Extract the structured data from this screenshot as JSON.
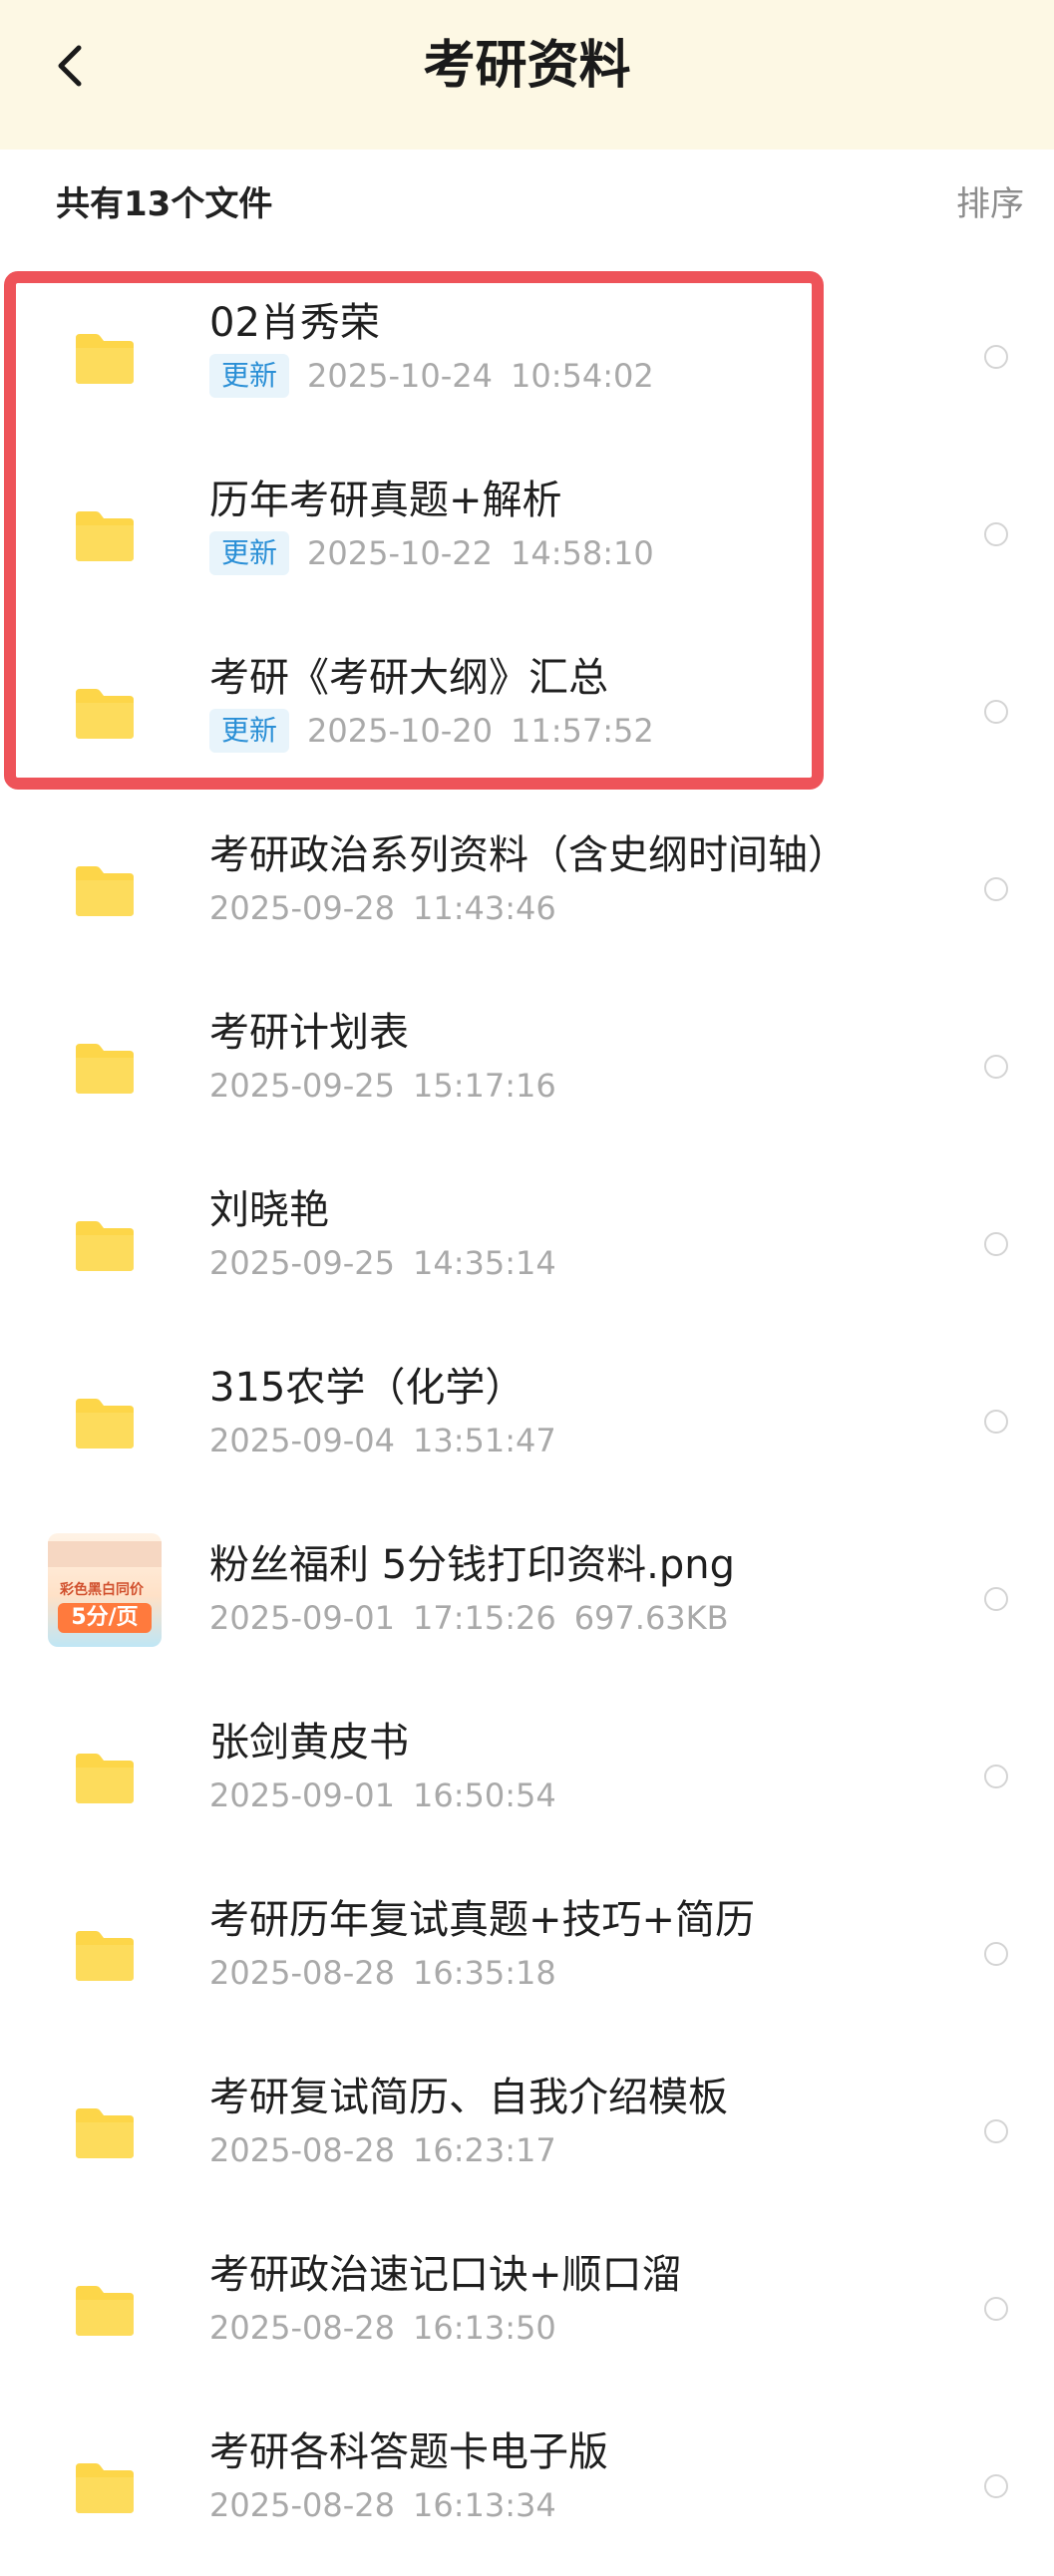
{
  "header": {
    "title": "考研资料",
    "back_icon": "back-arrow-icon"
  },
  "subheader": {
    "count_label": "共有13个文件",
    "sort_label": "排序"
  },
  "colors": {
    "header_bg": "#fdf8e4",
    "folder": "#fdd649",
    "update_badge_text": "#2a8fd6",
    "highlight": "#ee5359"
  },
  "files": [
    {
      "name": "02肖秀荣",
      "badge": "更新",
      "date": "2025-10-24",
      "time": "10:54:02",
      "size": "",
      "type": "folder",
      "icon": "folder-icon"
    },
    {
      "name": "历年考研真题+解析",
      "badge": "更新",
      "date": "2025-10-22",
      "time": "14:58:10",
      "size": "",
      "type": "folder",
      "icon": "folder-icon"
    },
    {
      "name": "考研《考研大纲》汇总",
      "badge": "更新",
      "date": "2025-10-20",
      "time": "11:57:52",
      "size": "",
      "type": "folder",
      "icon": "folder-icon"
    },
    {
      "name": "考研政治系列资料（含史纲时间轴）",
      "badge": "",
      "date": "2025-09-28",
      "time": "11:43:46",
      "size": "",
      "type": "folder",
      "icon": "folder-icon"
    },
    {
      "name": "考研计划表",
      "badge": "",
      "date": "2025-09-25",
      "time": "15:17:16",
      "size": "",
      "type": "folder",
      "icon": "folder-icon"
    },
    {
      "name": "刘晓艳",
      "badge": "",
      "date": "2025-09-25",
      "time": "14:35:14",
      "size": "",
      "type": "folder",
      "icon": "folder-icon"
    },
    {
      "name": "315农学（化学）",
      "badge": "",
      "date": "2025-09-04",
      "time": "13:51:47",
      "size": "",
      "type": "folder",
      "icon": "folder-icon"
    },
    {
      "name": "粉丝福利 5分钱打印资料.png",
      "badge": "",
      "date": "2025-09-01",
      "time": "17:15:26",
      "size": "697.63KB",
      "type": "image",
      "icon": "image-thumbnail",
      "thumb_text": "彩色黑白同价",
      "thumb_badge": "5分/页"
    },
    {
      "name": "张剑黄皮书",
      "badge": "",
      "date": "2025-09-01",
      "time": "16:50:54",
      "size": "",
      "type": "folder",
      "icon": "folder-icon"
    },
    {
      "name": "考研历年复试真题+技巧+简历",
      "badge": "",
      "date": "2025-08-28",
      "time": "16:35:18",
      "size": "",
      "type": "folder",
      "icon": "folder-icon"
    },
    {
      "name": "考研复试简历、自我介绍模板",
      "badge": "",
      "date": "2025-08-28",
      "time": "16:23:17",
      "size": "",
      "type": "folder",
      "icon": "folder-icon"
    },
    {
      "name": "考研政治速记口诀+顺口溜",
      "badge": "",
      "date": "2025-08-28",
      "time": "16:13:50",
      "size": "",
      "type": "folder",
      "icon": "folder-icon"
    },
    {
      "name": "考研各科答题卡电子版",
      "badge": "",
      "date": "2025-08-28",
      "time": "16:13:34",
      "size": "",
      "type": "folder",
      "icon": "folder-icon"
    }
  ]
}
